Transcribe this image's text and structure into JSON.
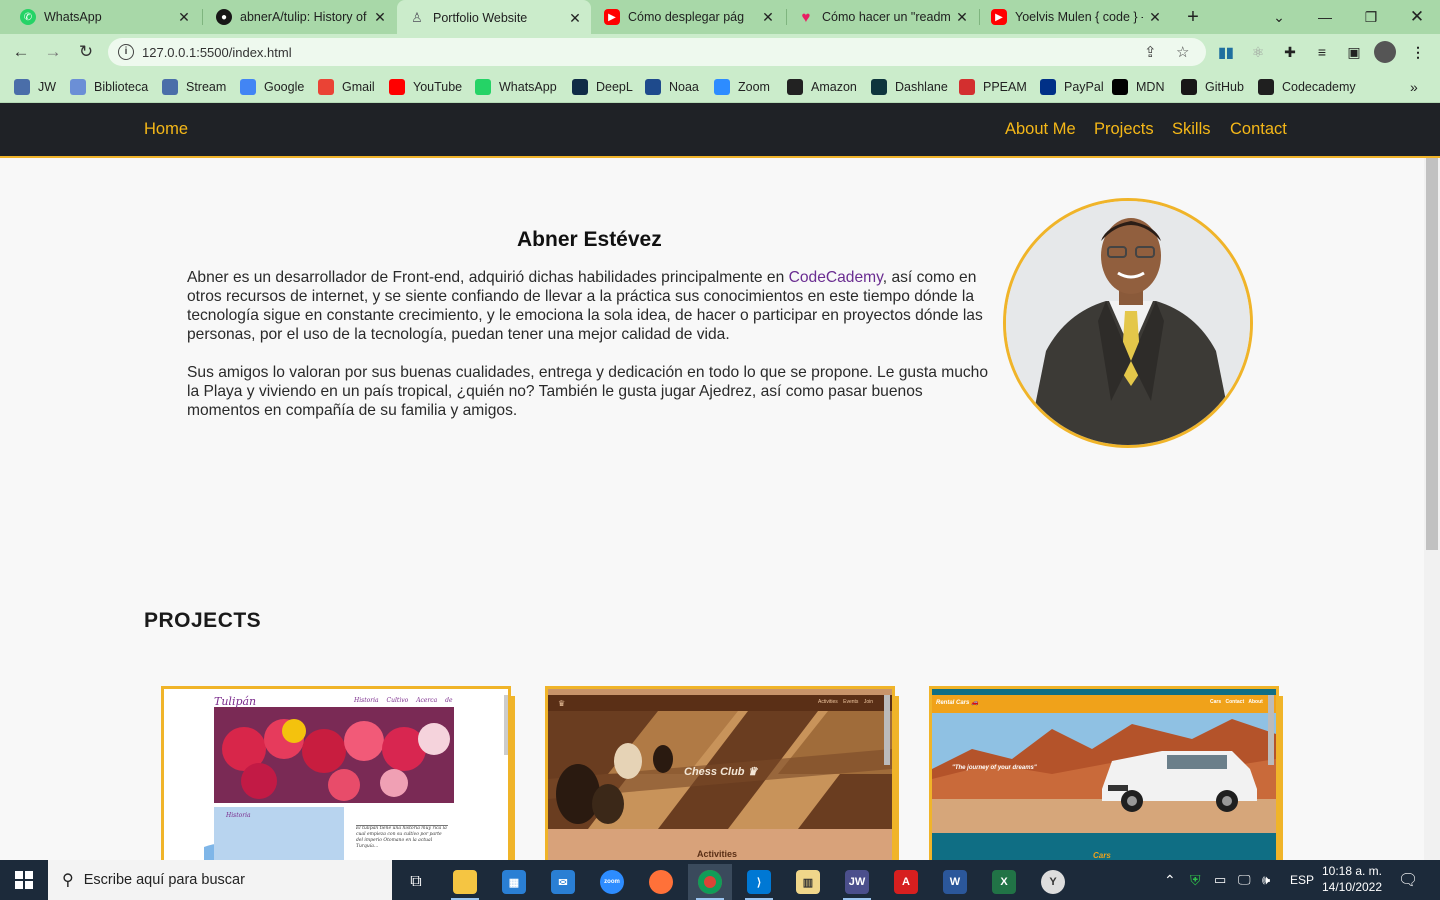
{
  "browser": {
    "tabs": [
      {
        "title": "WhatsApp",
        "color": "#25d366",
        "icon": "whatsapp-icon"
      },
      {
        "title": "abnerA/tulip: History of",
        "color": "#181717",
        "icon": "github-icon"
      },
      {
        "title": "Portfolio Website",
        "color": "#5f6368",
        "icon": "user-icon"
      },
      {
        "title": "Cómo desplegar pág",
        "color": "#ff0000",
        "icon": "youtube-icon"
      },
      {
        "title": "Cómo hacer un \"readme",
        "color": "#e91e63",
        "icon": "heart-icon"
      },
      {
        "title": "Yoelvis Mulen { code } -",
        "color": "#ff0000",
        "icon": "youtube-icon"
      }
    ],
    "url": "127.0.0.1:5500/index.html",
    "bookmarks": [
      {
        "label": "JW",
        "color": "#4a6ea9"
      },
      {
        "label": "Biblioteca",
        "color": "#6b8fd6"
      },
      {
        "label": "Stream",
        "color": "#4a6ea9"
      },
      {
        "label": "Google",
        "color": "#4285f4"
      },
      {
        "label": "Gmail",
        "color": "#ea4335"
      },
      {
        "label": "YouTube",
        "color": "#ff0000"
      },
      {
        "label": "WhatsApp",
        "color": "#25d366"
      },
      {
        "label": "DeepL",
        "color": "#0f2b46"
      },
      {
        "label": "Noaa",
        "color": "#1e4a8c"
      },
      {
        "label": "Zoom",
        "color": "#2d8cff"
      },
      {
        "label": "Amazon",
        "color": "#222222"
      },
      {
        "label": "Dashlane",
        "color": "#0e353d"
      },
      {
        "label": "PPEAM",
        "color": "#d32f2f"
      },
      {
        "label": "PayPal",
        "color": "#003087"
      },
      {
        "label": "MDN",
        "color": "#000000"
      },
      {
        "label": "GitHub",
        "color": "#181717"
      },
      {
        "label": "Codecademy",
        "color": "#1f1f1f"
      }
    ]
  },
  "site": {
    "nav": {
      "home": "Home",
      "about": "About Me",
      "projects": "Projects",
      "skills": "Skills",
      "contact": "Contact"
    },
    "about": {
      "name": "Abner Estévez",
      "p1_before": "Abner es un desarrollador de Front-end, adquirió dichas habilidades principalmente en ",
      "p1_link": "CodeCademy",
      "p1_after": ", así como en otros recursos de internet, y se siente confiando de llevar a la práctica sus conocimientos en este tiempo dónde la tecnología sigue en constante crecimiento, y le emociona la sola idea, de hacer o participar en proyectos dónde las personas, por el uso de la tecnología, puedan tener una mejor calidad de vida.",
      "p2": "Sus amigos lo valoran por sus buenas cualidades, entrega y dedicación en todo lo que se propone. Le gusta mucho la Playa y viviendo en un país tropical, ¿quién no? También le gusta jugar Ajedrez, así como pasar buenos momentos en compañía de su familia y amigos."
    },
    "projects_heading": "PROJECTS",
    "projects": [
      {
        "title": "Tulipán",
        "links": [
          "Historia",
          "Cultivo",
          "Acerca de"
        ],
        "section": "Historia",
        "blurb": "El tulipán tiene una historia muy rica la cual empieza con su cultivo por parte del imperio Otomano en la actual Turquía..."
      },
      {
        "title": "Chess Club",
        "links": [
          "Activities",
          "Events",
          "Join"
        ],
        "section": "Activities"
      },
      {
        "title": "Rental Cars",
        "links": [
          "Cars",
          "Contact",
          "About"
        ],
        "tagline": "\"The journey of your dreams\"",
        "section": "Cars"
      }
    ],
    "accent": "#f0b429",
    "nav_bg": "#1f2226"
  },
  "taskbar": {
    "search_placeholder": "Escribe aquí para buscar",
    "language": "ESP",
    "time": "10:18 a. m.",
    "date": "14/10/2022"
  }
}
